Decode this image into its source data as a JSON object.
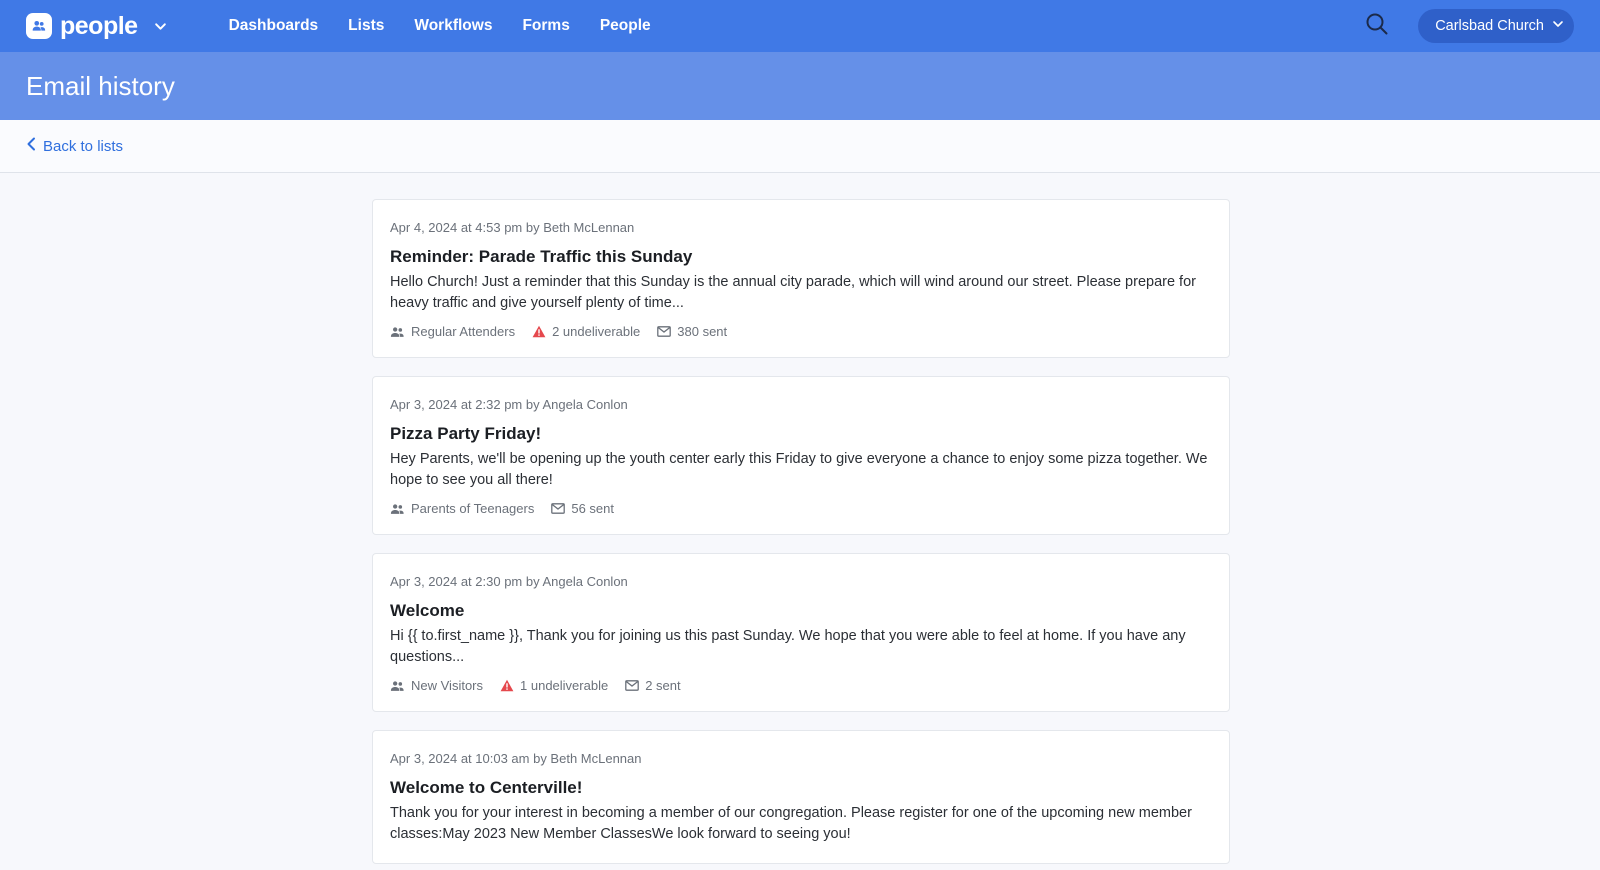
{
  "app": {
    "brand_name": "people",
    "nav": [
      "Dashboards",
      "Lists",
      "Workflows",
      "Forms",
      "People"
    ],
    "org_name": "Carlsbad Church"
  },
  "page": {
    "title": "Email history",
    "back_label": "Back to lists"
  },
  "emails": [
    {
      "meta": "Apr 4, 2024 at 4:53 pm by Beth McLennan",
      "subject": "Reminder: Parade Traffic this Sunday",
      "preview": "Hello Church! Just a reminder that this Sunday is the annual city parade, which will wind around our street. Please prepare for heavy traffic and give yourself plenty of time...",
      "list": "Regular Attenders",
      "undeliverable": "2 undeliverable",
      "sent": "380 sent"
    },
    {
      "meta": "Apr 3, 2024 at 2:32 pm by Angela Conlon",
      "subject": "Pizza Party Friday!",
      "preview": "Hey Parents, we'll be opening up the youth center early this Friday to give everyone a chance to enjoy some pizza together. We hope to see you all there!",
      "list": "Parents of Teenagers",
      "undeliverable": null,
      "sent": "56 sent"
    },
    {
      "meta": "Apr 3, 2024 at 2:30 pm by Angela Conlon",
      "subject": "Welcome",
      "preview": "Hi {{ to.first_name }}, Thank you for joining us this past Sunday. We hope that you were able to feel at home. If you have any questions...",
      "list": "New Visitors",
      "undeliverable": "1 undeliverable",
      "sent": "2 sent"
    },
    {
      "meta": "Apr 3, 2024 at 10:03 am by Beth McLennan",
      "subject": "Welcome to Centerville!",
      "preview": "Thank you for your interest in becoming a member of our congregation. Please register for one of the upcoming new member classes:May 2023 New Member ClassesWe look forward to seeing you!",
      "list": null,
      "undeliverable": null,
      "sent": null
    }
  ],
  "colors": {
    "topbar": "#4079e6",
    "titlebar": "#6590e8",
    "link": "#2f6fde",
    "warning": "#e5484d"
  }
}
